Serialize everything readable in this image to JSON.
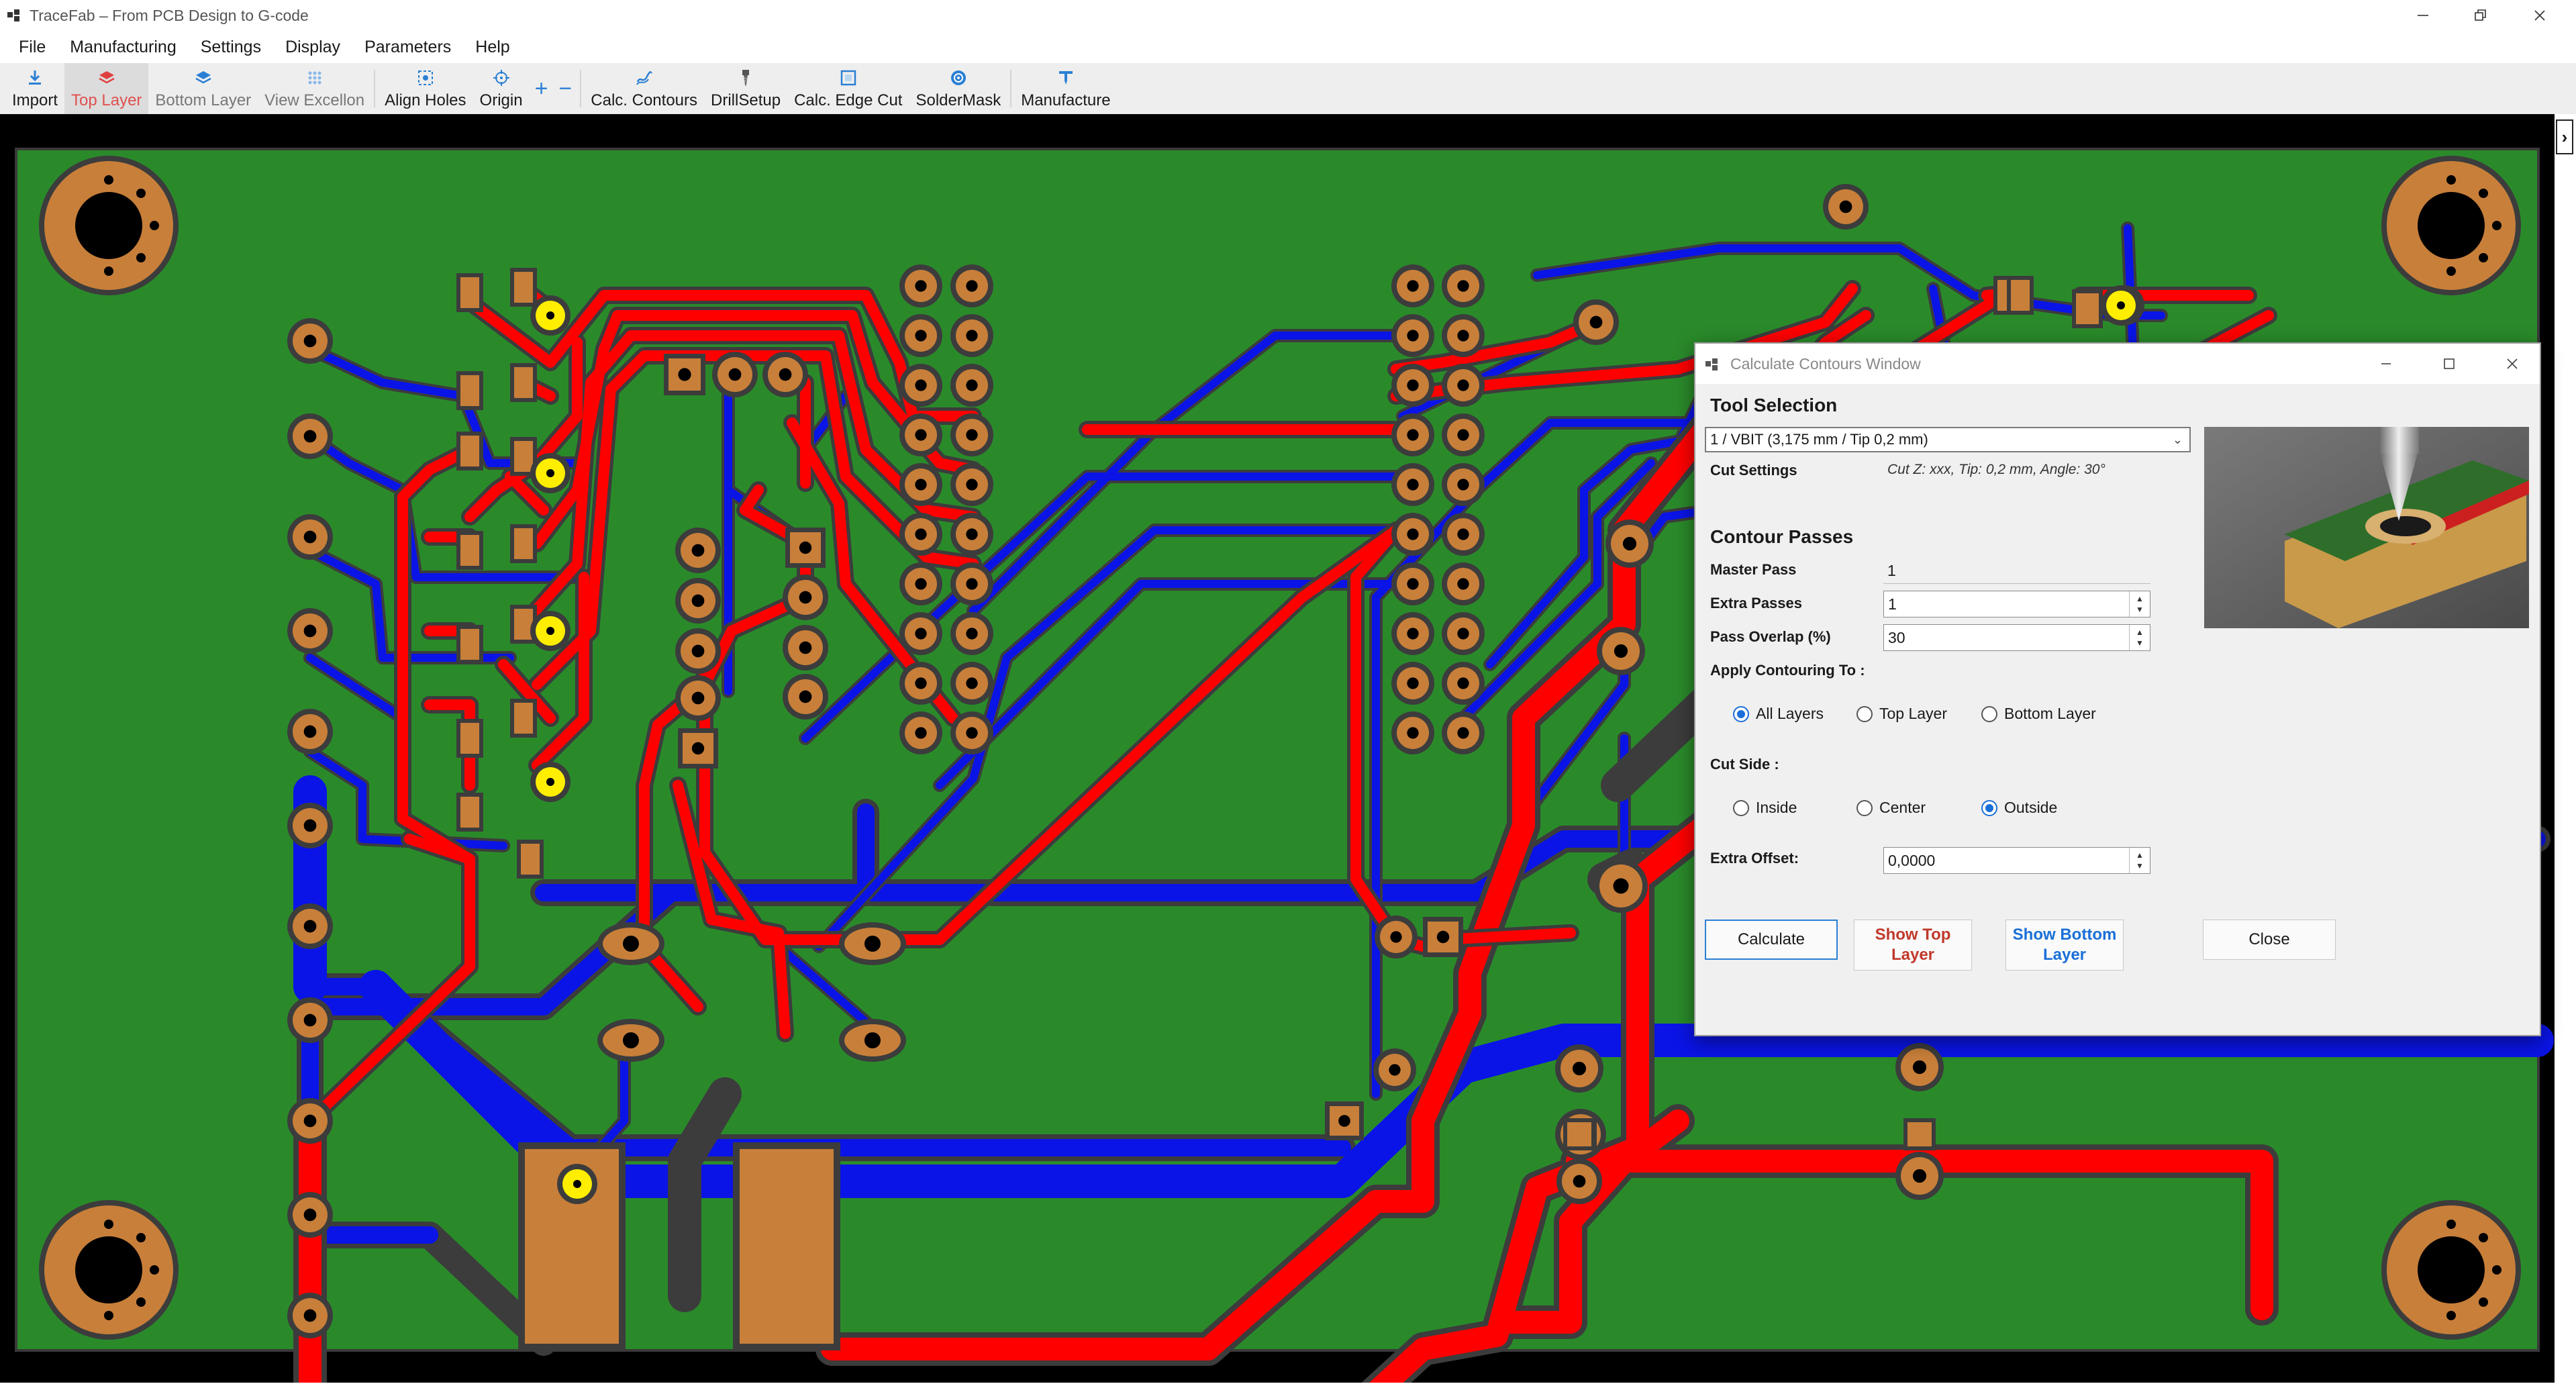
{
  "app": {
    "title": "TraceFab – From PCB Design to G-code"
  },
  "menu": [
    "File",
    "Manufacturing",
    "Settings",
    "Display",
    "Parameters",
    "Help"
  ],
  "toolbar": {
    "import": "Import",
    "top_layer": "Top Layer",
    "bottom_layer": "Bottom Layer",
    "view_excellon": "View Excellon",
    "align_holes": "Align Holes",
    "origin": "Origin",
    "zoom_in": "+",
    "zoom_out": "−",
    "calc_contours": "Calc. Contours",
    "drill_setup": "DrillSetup",
    "calc_edge_cut": "Calc. Edge Cut",
    "solder_mask": "SolderMask",
    "manufacture": "Manufacture"
  },
  "colors": {
    "board": "#2a8a2a",
    "top_trace": "#ff0000",
    "bottom_trace": "#0a14e6",
    "pad": "#c87f3a",
    "via": "#ffee00",
    "accent": "#1a6fd8"
  },
  "dialog": {
    "title": "Calculate Contours Window",
    "tool_selection_header": "Tool Selection",
    "tool_value": "1 / VBIT (3,175 mm / Tip 0,2 mm)",
    "cut_settings_label": "Cut Settings",
    "cut_settings_value": "Cut Z: xxx, Tip: 0,2 mm, Angle: 30°",
    "contour_passes_header": "Contour Passes",
    "master_pass_label": "Master Pass",
    "master_pass_value": "1",
    "extra_passes_label": "Extra Passes",
    "extra_passes_value": "1",
    "pass_overlap_label": "Pass Overlap (%)",
    "pass_overlap_value": "30",
    "apply_to_label": "Apply Contouring To :",
    "apply_all": "All Layers",
    "apply_top": "Top Layer",
    "apply_bottom": "Bottom Layer",
    "apply_selected": "All Layers",
    "cut_side_label": "Cut Side :",
    "side_inside": "Inside",
    "side_center": "Center",
    "side_outside": "Outside",
    "side_selected": "Outside",
    "extra_offset_label": "Extra Offset:",
    "extra_offset_value": "0,0000",
    "calculate_button": "Calculate",
    "show_top_button": "Show Top Layer",
    "show_bottom_button": "Show Bottom Layer",
    "close_button": "Close"
  },
  "right_panel": {
    "expand_glyph": "›"
  }
}
